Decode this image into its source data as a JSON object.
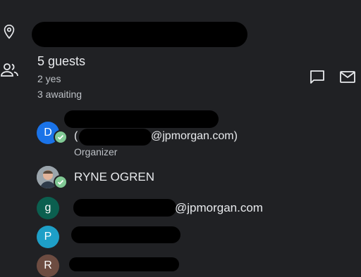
{
  "guests": {
    "summary": "5 guests",
    "yes": "2 yes",
    "awaiting": "3 awaiting"
  },
  "attendees": [
    {
      "initial": "D",
      "color": "#1a73e8",
      "email_open": "(",
      "email_domain": "@jpmorgan.com)",
      "role": "Organizer"
    },
    {
      "name": "RYNE OGREN"
    },
    {
      "initial": "g",
      "color": "#0b5f4f",
      "email_domain": "@jpmorgan.com"
    },
    {
      "initial": "P",
      "color": "#1e9fc7"
    },
    {
      "initial": "R",
      "color": "#6d4c41"
    }
  ],
  "icons": {
    "location": "location-pin-icon",
    "guests": "people-icon",
    "chat": "chat-icon",
    "mail": "mail-icon",
    "check": "check-icon"
  }
}
